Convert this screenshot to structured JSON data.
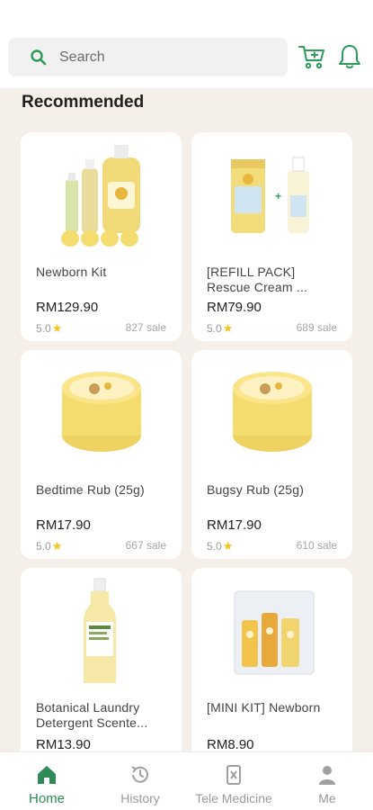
{
  "header": {
    "search_placeholder": "Search",
    "icons": [
      "search-icon",
      "cart-icon",
      "bell-icon"
    ],
    "accent_color": "#2e9b5a"
  },
  "section": {
    "title": "Recommended"
  },
  "products": [
    {
      "name": "Newborn Kit",
      "price": "RM129.90",
      "rating": "5.0",
      "sales": "827 sale"
    },
    {
      "name": "[REFILL PACK] Rescue Cream ...",
      "price": "RM79.90",
      "rating": "5.0",
      "sales": "689 sale"
    },
    {
      "name": "Bedtime Rub (25g)",
      "price": "RM17.90",
      "rating": "5.0",
      "sales": "667 sale"
    },
    {
      "name": "Bugsy Rub (25g)",
      "price": "RM17.90",
      "rating": "5.0",
      "sales": "610 sale"
    },
    {
      "name": "Botanical Laundry Detergent Scente...",
      "price": "RM13.90",
      "rating": "",
      "sales": ""
    },
    {
      "name": "[MINI KIT] Newborn",
      "price": "RM8.90",
      "rating": "",
      "sales": ""
    }
  ],
  "nav": {
    "items": [
      {
        "label": "Home",
        "icon": "home-icon",
        "active": true
      },
      {
        "label": "History",
        "icon": "history-icon",
        "active": false
      },
      {
        "label": "Tele Medicine",
        "icon": "tele-medicine-icon",
        "active": false
      },
      {
        "label": "Me",
        "icon": "person-icon",
        "active": false
      }
    ],
    "active_color": "#2e8b57",
    "inactive_color": "#9a9a9a"
  }
}
